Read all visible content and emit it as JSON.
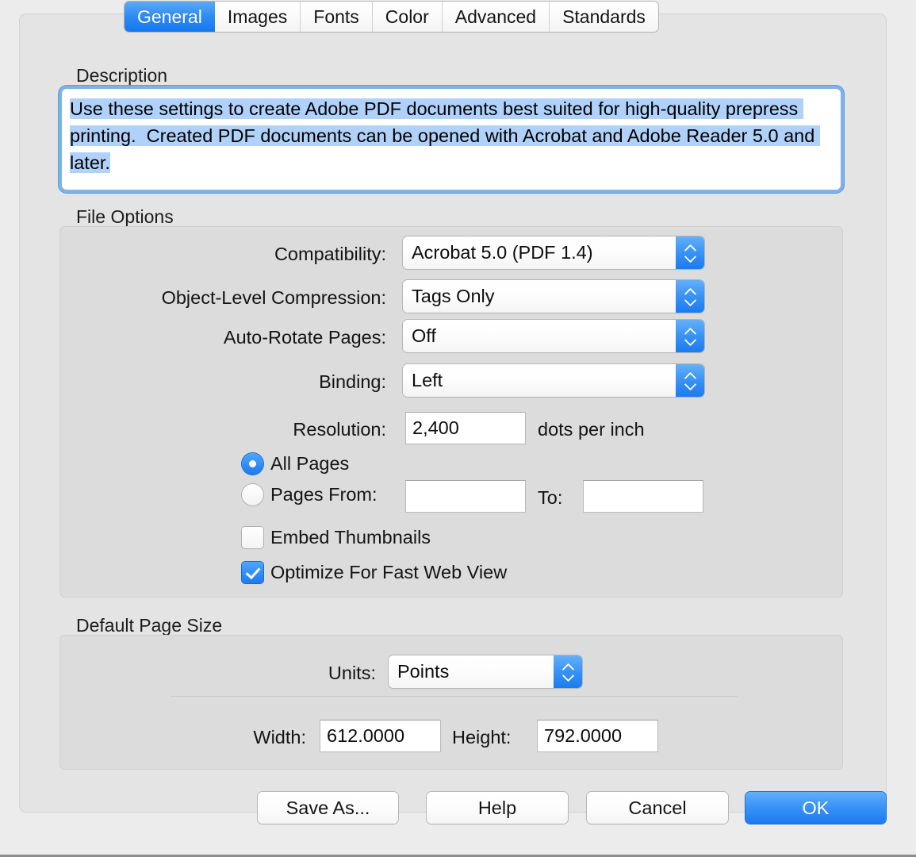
{
  "window": {
    "tabs": [
      {
        "label": "General",
        "active": true
      },
      {
        "label": "Images",
        "active": false
      },
      {
        "label": "Fonts",
        "active": false
      },
      {
        "label": "Color",
        "active": false
      },
      {
        "label": "Advanced",
        "active": false
      },
      {
        "label": "Standards",
        "active": false
      }
    ]
  },
  "description": {
    "title": "Description",
    "selected_text": "Use these settings to create Adobe PDF documents best suited for high-quality prepress printing.  Created PDF documents can be opened with Acrobat and Adobe Reader 5.0 and later."
  },
  "file_options": {
    "title": "File Options",
    "compatibility": {
      "label": "Compatibility:",
      "value": "Acrobat 5.0 (PDF 1.4)"
    },
    "object_level_compression": {
      "label": "Object-Level Compression:",
      "value": "Tags Only"
    },
    "auto_rotate_pages": {
      "label": "Auto-Rotate Pages:",
      "value": "Off"
    },
    "binding": {
      "label": "Binding:",
      "value": "Left"
    },
    "resolution": {
      "label": "Resolution:",
      "value": "2,400",
      "units": "dots per inch"
    },
    "all_pages": {
      "label": "All Pages",
      "checked": true
    },
    "pages_from": {
      "label": "Pages From:",
      "checked": false,
      "value": ""
    },
    "pages_to": {
      "label": "To:",
      "value": ""
    },
    "embed_thumbnails": {
      "label": "Embed Thumbnails",
      "checked": false
    },
    "optimize_fast_web_view": {
      "label": "Optimize For Fast Web View",
      "checked": true
    }
  },
  "default_page_size": {
    "title": "Default Page Size",
    "units": {
      "label": "Units:",
      "value": "Points"
    },
    "width": {
      "label": "Width:",
      "value": "612.0000"
    },
    "height": {
      "label": "Height:",
      "value": "792.0000"
    }
  },
  "buttons": {
    "save_as": "Save As...",
    "help": "Help",
    "cancel": "Cancel",
    "ok": "OK"
  },
  "colors": {
    "accent_blue": "#1b7bef",
    "selection_blue": "#b0d2fa",
    "focus_ring": "#7fb2ea",
    "panel_bg": "#e4e4e4",
    "window_bg": "#ececec"
  }
}
